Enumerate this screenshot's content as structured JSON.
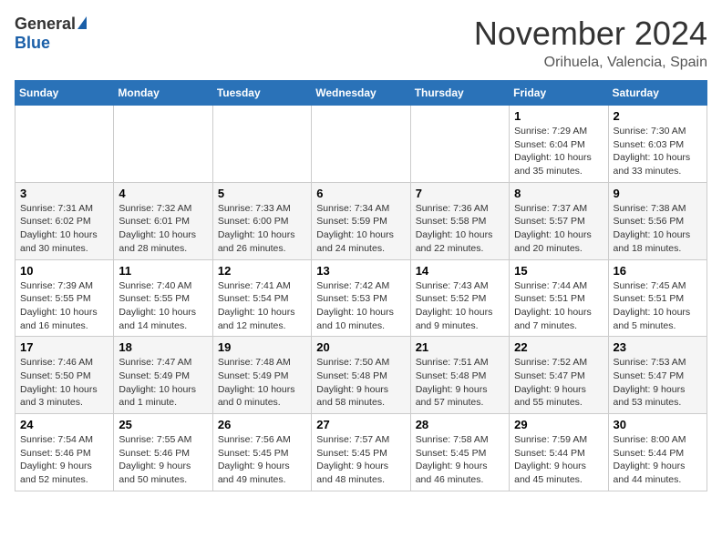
{
  "header": {
    "logo_general": "General",
    "logo_blue": "Blue",
    "month_title": "November 2024",
    "location": "Orihuela, Valencia, Spain"
  },
  "calendar": {
    "days_of_week": [
      "Sunday",
      "Monday",
      "Tuesday",
      "Wednesday",
      "Thursday",
      "Friday",
      "Saturday"
    ],
    "weeks": [
      [
        {
          "day": "",
          "info": ""
        },
        {
          "day": "",
          "info": ""
        },
        {
          "day": "",
          "info": ""
        },
        {
          "day": "",
          "info": ""
        },
        {
          "day": "",
          "info": ""
        },
        {
          "day": "1",
          "info": "Sunrise: 7:29 AM\nSunset: 6:04 PM\nDaylight: 10 hours and 35 minutes."
        },
        {
          "day": "2",
          "info": "Sunrise: 7:30 AM\nSunset: 6:03 PM\nDaylight: 10 hours and 33 minutes."
        }
      ],
      [
        {
          "day": "3",
          "info": "Sunrise: 7:31 AM\nSunset: 6:02 PM\nDaylight: 10 hours and 30 minutes."
        },
        {
          "day": "4",
          "info": "Sunrise: 7:32 AM\nSunset: 6:01 PM\nDaylight: 10 hours and 28 minutes."
        },
        {
          "day": "5",
          "info": "Sunrise: 7:33 AM\nSunset: 6:00 PM\nDaylight: 10 hours and 26 minutes."
        },
        {
          "day": "6",
          "info": "Sunrise: 7:34 AM\nSunset: 5:59 PM\nDaylight: 10 hours and 24 minutes."
        },
        {
          "day": "7",
          "info": "Sunrise: 7:36 AM\nSunset: 5:58 PM\nDaylight: 10 hours and 22 minutes."
        },
        {
          "day": "8",
          "info": "Sunrise: 7:37 AM\nSunset: 5:57 PM\nDaylight: 10 hours and 20 minutes."
        },
        {
          "day": "9",
          "info": "Sunrise: 7:38 AM\nSunset: 5:56 PM\nDaylight: 10 hours and 18 minutes."
        }
      ],
      [
        {
          "day": "10",
          "info": "Sunrise: 7:39 AM\nSunset: 5:55 PM\nDaylight: 10 hours and 16 minutes."
        },
        {
          "day": "11",
          "info": "Sunrise: 7:40 AM\nSunset: 5:55 PM\nDaylight: 10 hours and 14 minutes."
        },
        {
          "day": "12",
          "info": "Sunrise: 7:41 AM\nSunset: 5:54 PM\nDaylight: 10 hours and 12 minutes."
        },
        {
          "day": "13",
          "info": "Sunrise: 7:42 AM\nSunset: 5:53 PM\nDaylight: 10 hours and 10 minutes."
        },
        {
          "day": "14",
          "info": "Sunrise: 7:43 AM\nSunset: 5:52 PM\nDaylight: 10 hours and 9 minutes."
        },
        {
          "day": "15",
          "info": "Sunrise: 7:44 AM\nSunset: 5:51 PM\nDaylight: 10 hours and 7 minutes."
        },
        {
          "day": "16",
          "info": "Sunrise: 7:45 AM\nSunset: 5:51 PM\nDaylight: 10 hours and 5 minutes."
        }
      ],
      [
        {
          "day": "17",
          "info": "Sunrise: 7:46 AM\nSunset: 5:50 PM\nDaylight: 10 hours and 3 minutes."
        },
        {
          "day": "18",
          "info": "Sunrise: 7:47 AM\nSunset: 5:49 PM\nDaylight: 10 hours and 1 minute."
        },
        {
          "day": "19",
          "info": "Sunrise: 7:48 AM\nSunset: 5:49 PM\nDaylight: 10 hours and 0 minutes."
        },
        {
          "day": "20",
          "info": "Sunrise: 7:50 AM\nSunset: 5:48 PM\nDaylight: 9 hours and 58 minutes."
        },
        {
          "day": "21",
          "info": "Sunrise: 7:51 AM\nSunset: 5:48 PM\nDaylight: 9 hours and 57 minutes."
        },
        {
          "day": "22",
          "info": "Sunrise: 7:52 AM\nSunset: 5:47 PM\nDaylight: 9 hours and 55 minutes."
        },
        {
          "day": "23",
          "info": "Sunrise: 7:53 AM\nSunset: 5:47 PM\nDaylight: 9 hours and 53 minutes."
        }
      ],
      [
        {
          "day": "24",
          "info": "Sunrise: 7:54 AM\nSunset: 5:46 PM\nDaylight: 9 hours and 52 minutes."
        },
        {
          "day": "25",
          "info": "Sunrise: 7:55 AM\nSunset: 5:46 PM\nDaylight: 9 hours and 50 minutes."
        },
        {
          "day": "26",
          "info": "Sunrise: 7:56 AM\nSunset: 5:45 PM\nDaylight: 9 hours and 49 minutes."
        },
        {
          "day": "27",
          "info": "Sunrise: 7:57 AM\nSunset: 5:45 PM\nDaylight: 9 hours and 48 minutes."
        },
        {
          "day": "28",
          "info": "Sunrise: 7:58 AM\nSunset: 5:45 PM\nDaylight: 9 hours and 46 minutes."
        },
        {
          "day": "29",
          "info": "Sunrise: 7:59 AM\nSunset: 5:44 PM\nDaylight: 9 hours and 45 minutes."
        },
        {
          "day": "30",
          "info": "Sunrise: 8:00 AM\nSunset: 5:44 PM\nDaylight: 9 hours and 44 minutes."
        }
      ]
    ]
  }
}
